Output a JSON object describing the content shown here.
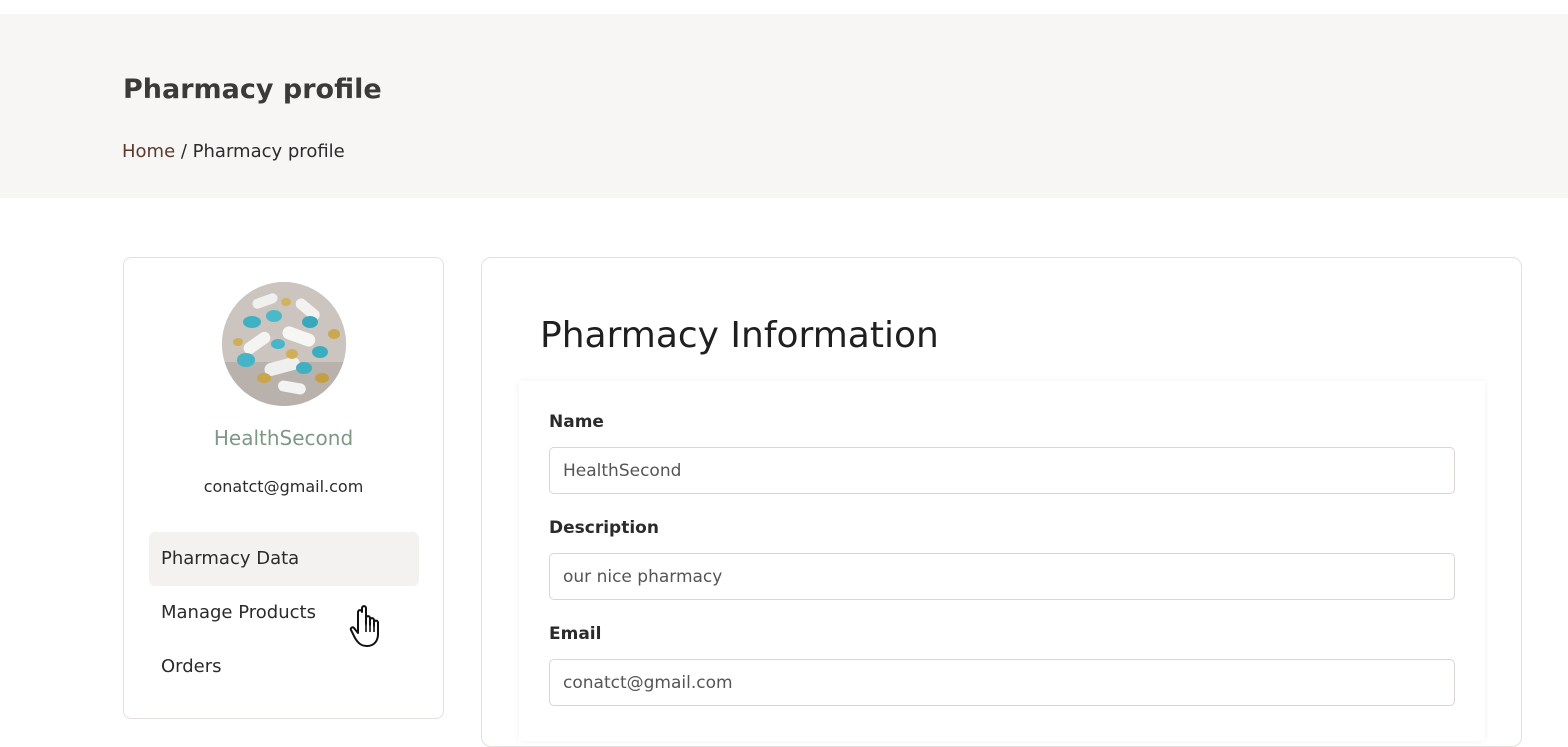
{
  "header": {
    "title": "Pharmacy profile",
    "breadcrumb": {
      "home": "Home",
      "separator": " / ",
      "current": "Pharmacy profile"
    }
  },
  "profile": {
    "avatar_icon": "pills-photo",
    "name": "HealthSecond",
    "email": "conatct@gmail.com",
    "name_color": "#7d9986"
  },
  "sidebar": {
    "items": [
      {
        "label": "Pharmacy Data",
        "active": true
      },
      {
        "label": "Manage Products",
        "active": false
      },
      {
        "label": "Orders",
        "active": false
      }
    ]
  },
  "main": {
    "title": "Pharmacy Information",
    "fields": [
      {
        "label": "Name",
        "value": "HealthSecond"
      },
      {
        "label": "Description",
        "value": "our nice pharmacy"
      },
      {
        "label": "Email",
        "value": "conatct@gmail.com"
      }
    ]
  },
  "cursor": {
    "icon": "hand-pointer-icon"
  }
}
